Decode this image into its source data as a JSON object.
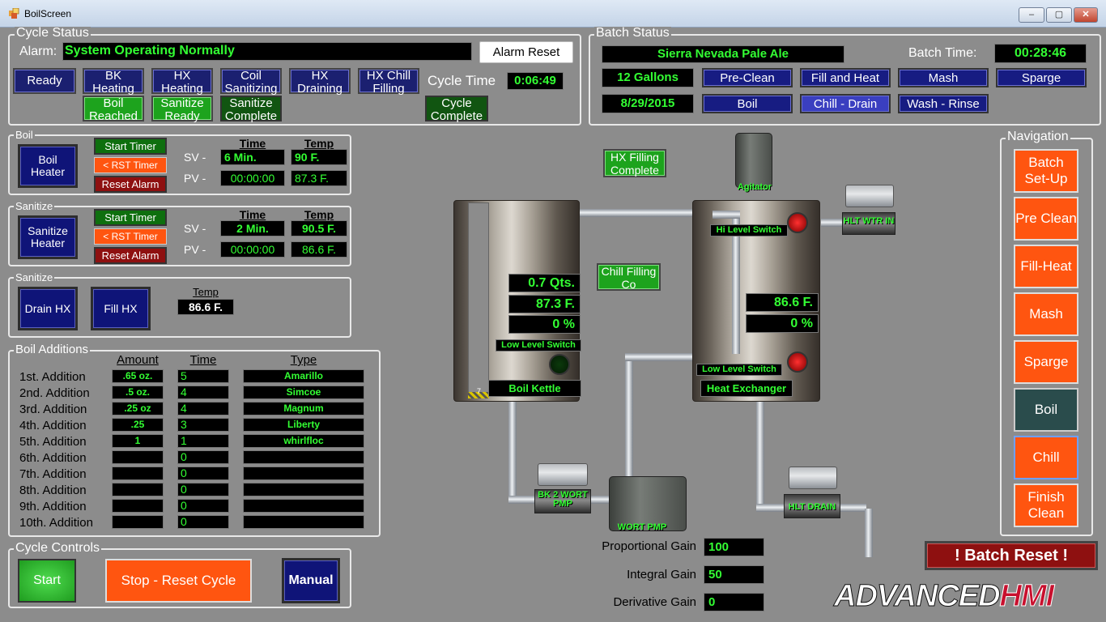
{
  "window": {
    "title": "BoilScreen",
    "min": "–",
    "max": "▢",
    "close": "✕"
  },
  "cycle_status": {
    "label": "Cycle Status",
    "alarm_label": "Alarm:",
    "alarm_text": "System Operating Normally",
    "alarm_reset": "Alarm Reset",
    "steps_row1": [
      "Ready",
      "BK Heating",
      "HX Heating",
      "Coil Sanitizing",
      "HX Draining",
      "HX Chill Filling"
    ],
    "steps_row2": [
      "Boil Reached",
      "Sanitize Ready",
      "Sanitize Complete"
    ],
    "cycle_time_label": "Cycle Time",
    "cycle_time": "0:06:49",
    "cycle_complete": "Cycle Complete"
  },
  "batch_status": {
    "label": "Batch Status",
    "recipe": "Sierra Nevada Pale Ale",
    "batch_time_label": "Batch Time:",
    "batch_time": "00:28:46",
    "volume": "12 Gallons",
    "date": "8/29/2015",
    "steps": [
      "Pre-Clean",
      "Fill and Heat",
      "Mash",
      "Sparge",
      "Boil",
      "Chill - Drain",
      "Wash - Rinse"
    ]
  },
  "boil": {
    "label": "Boil",
    "heater": "Boil Heater",
    "start_timer": "Start Timer",
    "rst_timer": "< RST Timer",
    "reset_alarm": "Reset Alarm",
    "time_hdr": "Time",
    "temp_hdr": "Temp",
    "sv_label": "SV -",
    "pv_label": "PV -",
    "sv_time": "6 Min.",
    "sv_temp": "90 F.",
    "pv_time": "00:00:00",
    "pv_temp": "87.3 F."
  },
  "sanitize1": {
    "label": "Sanitize",
    "heater": "Sanitize Heater",
    "start_timer": "Start Timer",
    "rst_timer": "< RST Timer",
    "reset_alarm": "Reset Alarm",
    "time_hdr": "Time",
    "temp_hdr": "Temp",
    "sv_label": "SV -",
    "pv_label": "PV -",
    "sv_time": "2 Min.",
    "sv_temp": "90.5 F.",
    "pv_time": "00:00:00",
    "pv_temp": "86.6 F."
  },
  "sanitize2": {
    "label": "Sanitize",
    "drain_hx": "Drain HX",
    "fill_hx": "Fill HX",
    "temp_hdr": "Temp",
    "temp": "86.6 F."
  },
  "boil_additions": {
    "label": "Boil Additions",
    "headers": {
      "amount": "Amount",
      "time": "Time",
      "type": "Type"
    },
    "rows": [
      {
        "label": "1st. Addition",
        "amount": ".65 oz.",
        "time": "5",
        "type": "Amarillo"
      },
      {
        "label": "2nd. Addition",
        "amount": ".5 oz.",
        "time": "4",
        "type": "Simcoe"
      },
      {
        "label": "3rd. Addition",
        "amount": ".25 oz",
        "time": "4",
        "type": "Magnum"
      },
      {
        "label": "4th. Addition",
        "amount": ".25",
        "time": "3",
        "type": "Liberty"
      },
      {
        "label": "5th. Addition",
        "amount": "1",
        "time": "1",
        "type": "whirlfloc"
      },
      {
        "label": "6th. Addition",
        "amount": "",
        "time": "0",
        "type": ""
      },
      {
        "label": "7th. Addition",
        "amount": "",
        "time": "0",
        "type": ""
      },
      {
        "label": "8th. Addition",
        "amount": "",
        "time": "0",
        "type": ""
      },
      {
        "label": "9th. Addition",
        "amount": "",
        "time": "0",
        "type": ""
      },
      {
        "label": "10th. Addition",
        "amount": "",
        "time": "0",
        "type": ""
      }
    ]
  },
  "cycle_controls": {
    "label": "Cycle Controls",
    "start": "Start",
    "stop": "Stop - Reset Cycle",
    "manual": "Manual"
  },
  "process": {
    "hx_filling_complete": "HX Filling Complete",
    "chill_filling": "Chill Filling Co",
    "agitator": "Agitator",
    "hlt_wtr_in": "HLT WTR IN",
    "hi_level_switch": "Hi Level Switch",
    "low_level_switch_bk": "Low Level Switch",
    "low_level_switch_hx": "Low Level Switch",
    "boil_kettle": "Boil Kettle",
    "heat_exchanger": "Heat Exchanger",
    "bk_volume": "0.7 Qts.",
    "bk_temp": "87.3 F.",
    "bk_pct": "0 %",
    "hx_temp": "86.6 F.",
    "hx_pct": "0 %",
    "bk_wort_pmp": "BK 2 WORT PMP",
    "wort_pmp": "WORT PMP",
    "hlt_drain": "HLT DRAIN",
    "gauge_mark": "7"
  },
  "pid": {
    "p_label": "Proportional Gain",
    "p": "100",
    "i_label": "Integral Gain",
    "i": "50",
    "d_label": "Derivative Gain",
    "d": "0"
  },
  "navigation": {
    "label": "Navigation",
    "items": [
      "Batch Set-Up",
      "Pre Clean",
      "Fill-Heat",
      "Mash",
      "Sparge",
      "Boil",
      "Chill",
      "Finish Clean"
    ]
  },
  "batch_reset": "! Batch Reset !",
  "logo": {
    "a": "ADVANCED",
    "b": "HMI"
  },
  "colors": {
    "lcd_text": "#33ff33",
    "nav": "#ff5510",
    "nav_active": "#2a4c4c",
    "indicator_blue": "#0f1478"
  }
}
